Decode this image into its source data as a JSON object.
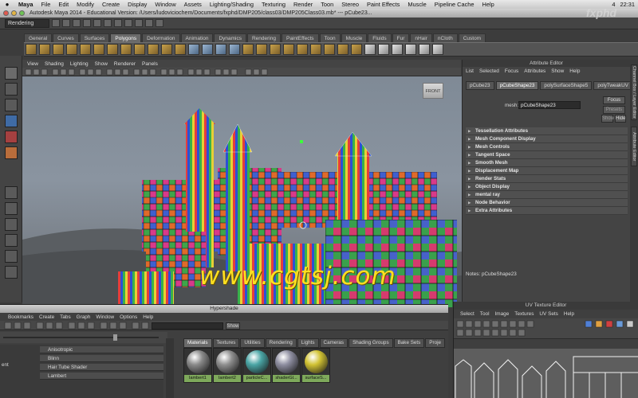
{
  "menubar": {
    "app": "Maya",
    "items": [
      "File",
      "Edit",
      "Modify",
      "Create",
      "Display",
      "Window",
      "Assets",
      "Lighting/Shading",
      "Texturing",
      "Render",
      "Toon",
      "Stereo",
      "Paint Effects",
      "Muscle",
      "Pipeline Cache",
      "Help"
    ],
    "right_text": "4",
    "clock": "22:31"
  },
  "window": {
    "title": "Autodesk Maya 2014 - Educational Version: /Users/ludoviciochem/Documents/fxphd/DMP205/class03/DMP205Class03.mb*   ---   pCube23..."
  },
  "statusline": {
    "mode": "Rendering"
  },
  "shelf": {
    "tabs": [
      "General",
      "Curves",
      "Surfaces",
      "Polygons",
      "Deformation",
      "Animation",
      "Dynamics",
      "Rendering",
      "PaintEffects",
      "Toon",
      "Muscle",
      "Fluids",
      "Fur",
      "nHair",
      "nCloth",
      "Custom"
    ],
    "active": "Polygons"
  },
  "viewport": {
    "menu": [
      "View",
      "Shading",
      "Lighting",
      "Show",
      "Renderer",
      "Panels"
    ],
    "viewcube_label": "FRONT"
  },
  "watermark": "www.cgtsj.com",
  "logo": "fxphd",
  "attribute_editor": {
    "title": "Attribute Editor",
    "menu": [
      "List",
      "Selected",
      "Focus",
      "Attributes",
      "Show",
      "Help"
    ],
    "tabs": [
      "pCube23",
      "pCubeShape23",
      "polySurfaceShape5",
      "polyTweakUV"
    ],
    "active_tab": "pCubeShape23",
    "mesh_label": "mesh:",
    "mesh_value": "pCubeShape23",
    "buttons": {
      "focus": "Focus",
      "presets": "Presets",
      "show": "Show",
      "hide": "Hide"
    },
    "sections": [
      "Tessellation Attributes",
      "Mesh Component Display",
      "Mesh Controls",
      "Tangent Space",
      "Smooth Mesh",
      "Displacement Map",
      "Render Stats",
      "Object Display",
      "mental ray",
      "Node Behavior",
      "Extra Attributes"
    ],
    "notes": "Notes:  pCubeShape23"
  },
  "side_tabs": [
    "Channel Box / Layer Editor",
    "Attribute Editor"
  ],
  "hypershade": {
    "title": "Hypershade",
    "menu": [
      "Bookmarks",
      "Create",
      "Tabs",
      "Graph",
      "Window",
      "Options",
      "Help"
    ],
    "show_button": "Show",
    "list": [
      "Anisotropic",
      "Blinn",
      "Hair Tube Shader",
      "Lambert"
    ],
    "list_left": "ent",
    "tabs": [
      "Materials",
      "Textures",
      "Utilities",
      "Rendering",
      "Lights",
      "Cameras",
      "Shading Groups",
      "Bake Sets",
      "Proje"
    ],
    "active_tab": "Materials",
    "swatches": [
      {
        "label": "lambert1",
        "color": "#8a8a8a"
      },
      {
        "label": "lambert2",
        "color": "#8f8f8f"
      },
      {
        "label": "particleC...",
        "color": "#4aa5a5"
      },
      {
        "label": "shaderGl...",
        "color": "#8e8ea0"
      },
      {
        "label": "surfaceS...",
        "color": "#d1c233"
      }
    ]
  },
  "uv_editor": {
    "title": "UV Texture Editor",
    "menu": [
      "Select",
      "Tool",
      "Image",
      "Textures",
      "UV Sets",
      "Help"
    ]
  },
  "colors": {
    "watermark": "#ffe020",
    "ui_bg": "#444444",
    "swatch_label": "#7ea95b"
  }
}
